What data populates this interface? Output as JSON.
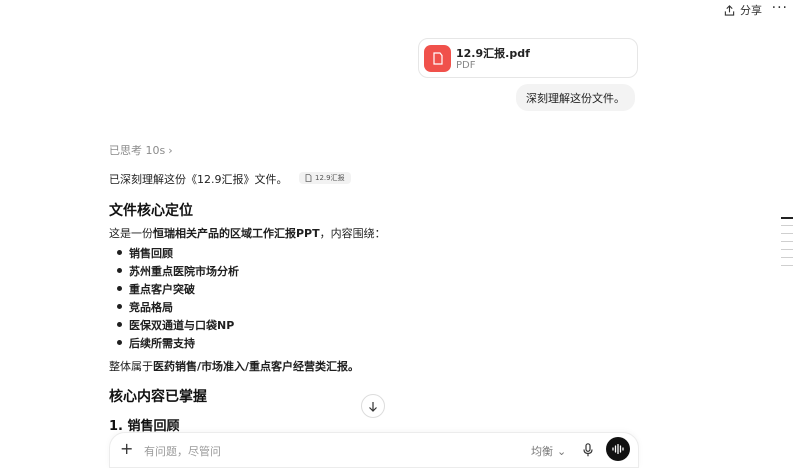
{
  "header": {
    "share_label": "分享",
    "more_label": "···"
  },
  "attachment": {
    "file_name": "12.9汇报.pdf",
    "file_type": "PDF",
    "icon": "pdf-file-icon",
    "icon_color": "#f0514b"
  },
  "user_message": "深刻理解这份文件。",
  "thinking": {
    "label": "已思考 10s",
    "chevron": "›"
  },
  "answer": {
    "intro": "已深刻理解这份《12.9汇报》文件。",
    "ref_chip": "12.9汇报",
    "section1_title": "文件核心定位",
    "section1_line_prefix": "这是一份",
    "section1_line_bold": "恒瑞相关产品的区域工作汇报PPT",
    "section1_line_suffix": "，内容围绕：",
    "bullets": [
      "销售回顾",
      "苏州重点医院市场分析",
      "重点客户突破",
      "竞品格局",
      "医保双通道与口袋NP",
      "后续所需支持"
    ],
    "summary_prefix": "整体属于",
    "summary_bold": "医药销售/市场准入/重点客户经营类汇报。",
    "section2_title": "核心内容已掌握",
    "subsection_title": "1. 销售回顾"
  },
  "composer": {
    "placeholder": "有问题，尽管问",
    "mode_label": "均衡",
    "mode_chevron": "⌄"
  },
  "colors": {
    "accent_pdf": "#f0514b",
    "voice_button": "#111111"
  }
}
